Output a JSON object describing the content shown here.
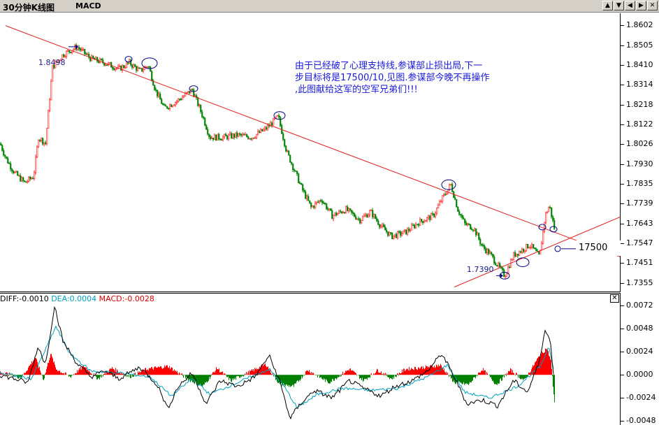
{
  "window": {
    "title": "30分钟K线图",
    "indicator": "MACD",
    "buttons": [
      "▲",
      "▼",
      "◀",
      "▶",
      "✕"
    ],
    "button_icons": [
      "scroll-up-icon",
      "scroll-down-icon",
      "scroll-left-icon",
      "scroll-right-icon",
      "close-icon"
    ]
  },
  "colors": {
    "up_candle": "#ff2020",
    "down_candle": "#008000",
    "trendline": "#e02020",
    "macd_pos": "#ff0000",
    "macd_neg": "#008000",
    "diff_line": "#000000",
    "dea_line": "#00a0c0",
    "note_text": "#1a1ad8"
  },
  "main_axis": {
    "labels": [
      "1.8602",
      "1.8505",
      "1.8410",
      "1.8314",
      "1.8218",
      "1.8122",
      "1.8026",
      "1.7930",
      "1.7835",
      "1.7739",
      "1.7643",
      "1.7547",
      "1.7451",
      "1.7355"
    ],
    "values": [
      1.8602,
      1.8505,
      1.841,
      1.8314,
      1.8218,
      1.8122,
      1.8026,
      1.793,
      1.7835,
      1.7739,
      1.7643,
      1.7547,
      1.7451,
      1.7355
    ]
  },
  "annotations": {
    "high": "1.8498",
    "low": "1.7390",
    "target": "17500",
    "note_lines": [
      "由于已经破了心理支持线,参谋部止损出局,下一",
      "步目标将是17500/10,见图.参谋部今晚不再操作",
      ",此图献给这军的空军兄弟们!!!"
    ]
  },
  "macd": {
    "diff_label": "DIFF:",
    "diff_value": "-0.0010",
    "dea_label": "DEA:",
    "dea_value": "0.0004",
    "macd_label": "MACD:",
    "macd_value": "-0.0028",
    "axis_labels": [
      "0.0072",
      "0.0048",
      "0.0024",
      "0.0000",
      "-0.0024",
      "-0.0048"
    ],
    "axis_values": [
      0.0072,
      0.0048,
      0.0024,
      0.0,
      -0.0024,
      -0.0048
    ]
  },
  "chart_data": {
    "type": "candlestick",
    "title": "30分钟K线图",
    "ylim": [
      1.731,
      1.866
    ],
    "price_path": [
      [
        0,
        1.803
      ],
      [
        8,
        1.796
      ],
      [
        20,
        1.789
      ],
      [
        35,
        1.784
      ],
      [
        48,
        1.787
      ],
      [
        55,
        1.806
      ],
      [
        65,
        1.803
      ],
      [
        75,
        1.84
      ],
      [
        90,
        1.846
      ],
      [
        110,
        1.8498
      ],
      [
        130,
        1.844
      ],
      [
        150,
        1.842
      ],
      [
        170,
        1.839
      ],
      [
        185,
        1.842
      ],
      [
        200,
        1.838
      ],
      [
        212,
        1.841
      ],
      [
        222,
        1.829
      ],
      [
        235,
        1.82
      ],
      [
        255,
        1.824
      ],
      [
        275,
        1.829
      ],
      [
        290,
        1.816
      ],
      [
        300,
        1.806
      ],
      [
        320,
        1.806
      ],
      [
        340,
        1.807
      ],
      [
        360,
        1.806
      ],
      [
        380,
        1.81
      ],
      [
        398,
        1.816
      ],
      [
        410,
        1.799
      ],
      [
        420,
        1.791
      ],
      [
        432,
        1.781
      ],
      [
        445,
        1.772
      ],
      [
        460,
        1.776
      ],
      [
        475,
        1.768
      ],
      [
        495,
        1.771
      ],
      [
        515,
        1.766
      ],
      [
        530,
        1.77
      ],
      [
        545,
        1.763
      ],
      [
        560,
        1.758
      ],
      [
        580,
        1.76
      ],
      [
        600,
        1.765
      ],
      [
        620,
        1.768
      ],
      [
        632,
        1.776
      ],
      [
        645,
        1.783
      ],
      [
        655,
        1.771
      ],
      [
        665,
        1.764
      ],
      [
        678,
        1.762
      ],
      [
        690,
        1.753
      ],
      [
        700,
        1.75
      ],
      [
        712,
        1.744
      ],
      [
        722,
        1.739
      ],
      [
        735,
        1.749
      ],
      [
        745,
        1.751
      ],
      [
        758,
        1.754
      ],
      [
        772,
        1.748
      ],
      [
        780,
        1.768
      ],
      [
        786,
        1.773
      ],
      [
        793,
        1.762
      ]
    ],
    "trendline_down": [
      [
        8,
        1.86
      ],
      [
        888,
        1.748
      ]
    ],
    "trendline_up": [
      [
        650,
        1.7335
      ],
      [
        888,
        1.7675
      ]
    ],
    "circled_points": [
      [
        184,
        1.8438
      ],
      [
        214,
        1.8418
      ],
      [
        277,
        1.8295
      ],
      [
        400,
        1.8165
      ],
      [
        642,
        1.783
      ],
      [
        722,
        1.739
      ],
      [
        748,
        1.7455
      ],
      [
        776,
        1.7625
      ],
      [
        792,
        1.7615
      ],
      [
        798,
        1.752
      ]
    ],
    "high_label": "1.8498",
    "low_label": "1.7390",
    "target_label": "17500",
    "macd_histogram": [
      [
        0,
        0.0003
      ],
      [
        30,
        -0.0003
      ],
      [
        50,
        0.0018
      ],
      [
        62,
        -0.0005
      ],
      [
        72,
        0.0022
      ],
      [
        80,
        0.0006
      ],
      [
        100,
        -0.0002
      ],
      [
        120,
        0.0009
      ],
      [
        140,
        -0.0004
      ],
      [
        160,
        0.0007
      ],
      [
        185,
        -0.0002
      ],
      [
        210,
        0.0006
      ],
      [
        240,
        0.0009
      ],
      [
        270,
        -0.0005
      ],
      [
        290,
        -0.0012
      ],
      [
        310,
        0.0007
      ],
      [
        330,
        -0.0006
      ],
      [
        360,
        0.0004
      ],
      [
        380,
        0.0011
      ],
      [
        400,
        -0.001
      ],
      [
        420,
        -0.0012
      ],
      [
        440,
        0.0005
      ],
      [
        470,
        -0.0008
      ],
      [
        500,
        0.0006
      ],
      [
        520,
        -0.0006
      ],
      [
        540,
        0.0005
      ],
      [
        560,
        -0.0004
      ],
      [
        580,
        0.0006
      ],
      [
        610,
        0.0008
      ],
      [
        630,
        0.001
      ],
      [
        650,
        -0.0008
      ],
      [
        670,
        -0.001
      ],
      [
        690,
        0.0006
      ],
      [
        710,
        -0.001
      ],
      [
        730,
        0.0005
      ],
      [
        750,
        -0.0006
      ],
      [
        770,
        0.0018
      ],
      [
        782,
        0.0028
      ],
      [
        788,
        0.0014
      ],
      [
        793,
        -0.0028
      ]
    ],
    "macd_diff": [
      [
        0,
        0.0
      ],
      [
        40,
        -0.0008
      ],
      [
        55,
        0.003
      ],
      [
        65,
        0.001
      ],
      [
        78,
        0.0072
      ],
      [
        90,
        0.0035
      ],
      [
        110,
        0.0012
      ],
      [
        130,
        -0.0002
      ],
      [
        150,
        0.0004
      ],
      [
        170,
        -0.0004
      ],
      [
        200,
        0.0008
      ],
      [
        225,
        -0.001
      ],
      [
        240,
        -0.0035
      ],
      [
        255,
        -0.0012
      ],
      [
        275,
        0.0002
      ],
      [
        295,
        -0.003
      ],
      [
        315,
        -0.0006
      ],
      [
        340,
        -0.0012
      ],
      [
        365,
        -0.0002
      ],
      [
        385,
        0.002
      ],
      [
        400,
        -0.0006
      ],
      [
        415,
        -0.0045
      ],
      [
        430,
        -0.003
      ],
      [
        450,
        -0.0016
      ],
      [
        475,
        -0.0024
      ],
      [
        500,
        -0.0006
      ],
      [
        520,
        -0.0014
      ],
      [
        545,
        -0.0022
      ],
      [
        565,
        -0.0012
      ],
      [
        590,
        -0.0006
      ],
      [
        612,
        0.0004
      ],
      [
        632,
        0.0022
      ],
      [
        650,
        -0.0002
      ],
      [
        668,
        -0.003
      ],
      [
        690,
        -0.0026
      ],
      [
        712,
        -0.0032
      ],
      [
        735,
        -0.0006
      ],
      [
        755,
        -0.0018
      ],
      [
        770,
        0.001
      ],
      [
        780,
        0.0046
      ],
      [
        788,
        0.0034
      ],
      [
        793,
        -0.001
      ]
    ],
    "macd_dea": [
      [
        0,
        0.0002
      ],
      [
        45,
        -0.0004
      ],
      [
        60,
        0.0018
      ],
      [
        80,
        0.005
      ],
      [
        100,
        0.0022
      ],
      [
        130,
        0.0004
      ],
      [
        170,
        0.0002
      ],
      [
        215,
        -0.0002
      ],
      [
        245,
        -0.0022
      ],
      [
        275,
        -0.0004
      ],
      [
        300,
        -0.002
      ],
      [
        340,
        -0.0008
      ],
      [
        385,
        0.0006
      ],
      [
        405,
        -0.001
      ],
      [
        425,
        -0.0034
      ],
      [
        455,
        -0.002
      ],
      [
        490,
        -0.0014
      ],
      [
        530,
        -0.0016
      ],
      [
        570,
        -0.0014
      ],
      [
        612,
        -0.0002
      ],
      [
        640,
        0.001
      ],
      [
        665,
        -0.0018
      ],
      [
        700,
        -0.0024
      ],
      [
        740,
        -0.0012
      ],
      [
        775,
        0.001
      ],
      [
        785,
        0.003
      ],
      [
        793,
        0.0004
      ]
    ]
  }
}
